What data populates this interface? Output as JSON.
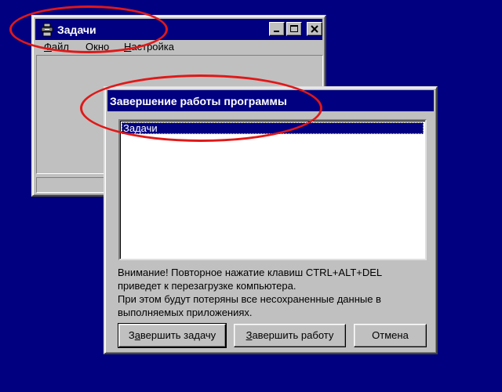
{
  "background_color": "#000080",
  "taskmgr": {
    "title": "Задачи",
    "icon": "task-manager-icon",
    "controls": {
      "minimize": "_",
      "maximize": "□",
      "close": "✕"
    },
    "menu": [
      {
        "label_ul": "Ф",
        "label_rest": "айл"
      },
      {
        "label_ul": "О",
        "label_rest": "кно"
      },
      {
        "label_ul": "Н",
        "label_rest": "астройка"
      }
    ]
  },
  "dialog": {
    "title": "Завершение работы программы",
    "tasks": [
      "Задачи"
    ],
    "warning_lines": [
      "Внимание! Повторное нажатие клавиш CTRL+ALT+DEL",
      "приведет к перезагрузке компьютера.",
      "При этом будут потеряны все несохраненные данные в",
      "выполняемых приложениях."
    ],
    "buttons": {
      "end_task": {
        "pre": "З",
        "ul": "а",
        "post": "вершить задачу"
      },
      "shut_down": {
        "pre": "",
        "ul": "З",
        "post": "авершить работу"
      },
      "cancel": "Отмена"
    }
  },
  "annotation_color": "#e01818"
}
